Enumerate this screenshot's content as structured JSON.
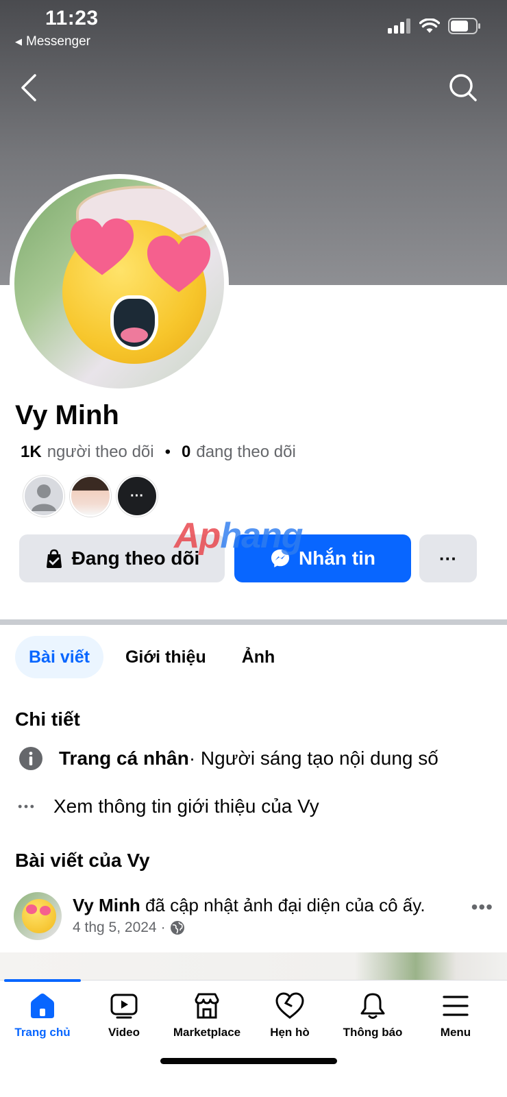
{
  "status_bar": {
    "time": "11:23",
    "back_app": "Messenger",
    "back_arrow_icon": "small-left-triangle-icon",
    "signal_icon": "cellular-signal-icon",
    "wifi_icon": "wifi-icon",
    "battery_icon": "battery-icon"
  },
  "top_nav": {
    "back_icon": "chevron-left-icon",
    "search_icon": "search-icon"
  },
  "profile": {
    "name": "Vy Minh",
    "followers_count": "1K",
    "followers_label": "người theo dõi",
    "separator": "•",
    "following_count": "0",
    "following_label": "đang theo dõi"
  },
  "friends_preview": [
    {
      "type": "default-avatar-icon"
    },
    {
      "type": "photo"
    },
    {
      "type": "more-dots-icon"
    }
  ],
  "actions": {
    "following_label": "Đang theo dõi",
    "following_icon": "following-check-icon",
    "message_label": "Nhắn tin",
    "message_icon": "messenger-icon",
    "more_label": "···"
  },
  "watermark": {
    "part1": "Ap",
    "part2": "hang"
  },
  "tabs": [
    {
      "label": "Bài viết",
      "active": true
    },
    {
      "label": "Giới thiệu",
      "active": false
    },
    {
      "label": "Ảnh",
      "active": false
    }
  ],
  "details": {
    "title": "Chi tiết",
    "page_type": "Trang cá nhân",
    "page_category": " · Người sáng tạo nội dung số",
    "see_about": "Xem thông tin giới thiệu của Vy"
  },
  "posts": {
    "title": "Bài viết của Vy",
    "author": "Vy Minh",
    "action": " đã cập nhật ảnh đại diện của cô ấy.",
    "date": "4 thg 5, 2024",
    "dot": "·",
    "privacy_icon": "globe-icon",
    "more_label": "•••"
  },
  "bottom_nav": [
    {
      "label": "Trang chủ",
      "icon": "home-icon",
      "active": true
    },
    {
      "label": "Video",
      "icon": "video-icon",
      "active": false
    },
    {
      "label": "Marketplace",
      "icon": "marketplace-icon",
      "active": false
    },
    {
      "label": "Hẹn hò",
      "icon": "heart-icon",
      "active": false
    },
    {
      "label": "Thông báo",
      "icon": "bell-icon",
      "active": false
    },
    {
      "label": "Menu",
      "icon": "menu-icon",
      "active": false
    }
  ],
  "colors": {
    "accent": "#0866ff",
    "secondary_button": "#e4e6eb",
    "muted_text": "#65676b"
  }
}
